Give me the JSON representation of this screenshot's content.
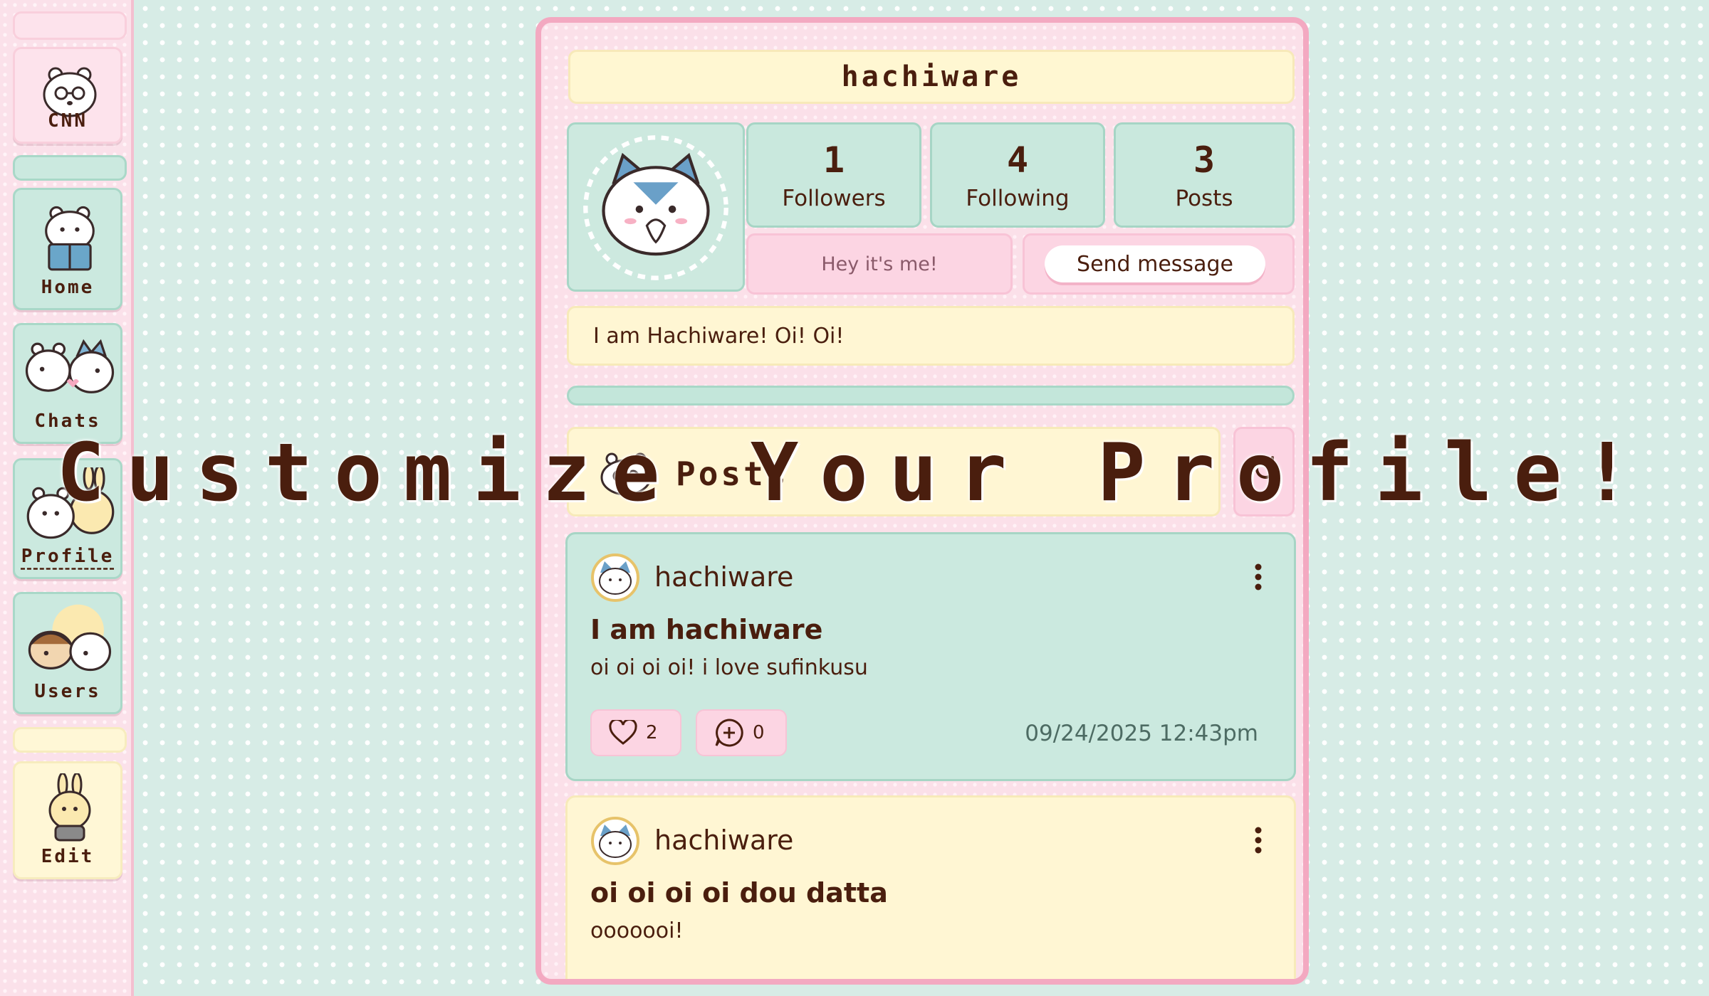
{
  "sidebar": {
    "items": [
      {
        "label": "CNN",
        "icon": "glasses-bear-icon"
      },
      {
        "label": "Home",
        "icon": "reading-bear-icon"
      },
      {
        "label": "Chats",
        "icon": "two-friends-icon"
      },
      {
        "label": "Profile",
        "icon": "bear-rabbit-icon"
      },
      {
        "label": "Users",
        "icon": "group-icon"
      },
      {
        "label": "Edit",
        "icon": "rabbit-icon"
      }
    ]
  },
  "profile": {
    "username": "hachiware",
    "stats": [
      {
        "value": "1",
        "label": "Followers"
      },
      {
        "value": "4",
        "label": "Following"
      },
      {
        "value": "3",
        "label": "Posts"
      }
    ],
    "greeting": "Hey it's me!",
    "send_message_label": "Send message",
    "bio": "I am Hachiware! Oi! Oi!"
  },
  "posts_section": {
    "title": "Posts",
    "refresh_icon": "refresh-icon"
  },
  "posts": [
    {
      "author": "hachiware",
      "title": "I am hachiware",
      "body": "oi oi oi oi! i love sufinkusu",
      "likes": "2",
      "comments": "0",
      "timestamp": "09/24/2025 12:43pm"
    },
    {
      "author": "hachiware",
      "title": "oi oi oi oi dou datta",
      "body": "ooooooi!"
    }
  ],
  "overlay_text": "Customize Your Profile!",
  "colors": {
    "text": "#4a1e0e",
    "pink": "#fde3ec",
    "mint": "#cbe9df",
    "cream": "#fff7d6",
    "panel_border": "#f3a9c1"
  }
}
